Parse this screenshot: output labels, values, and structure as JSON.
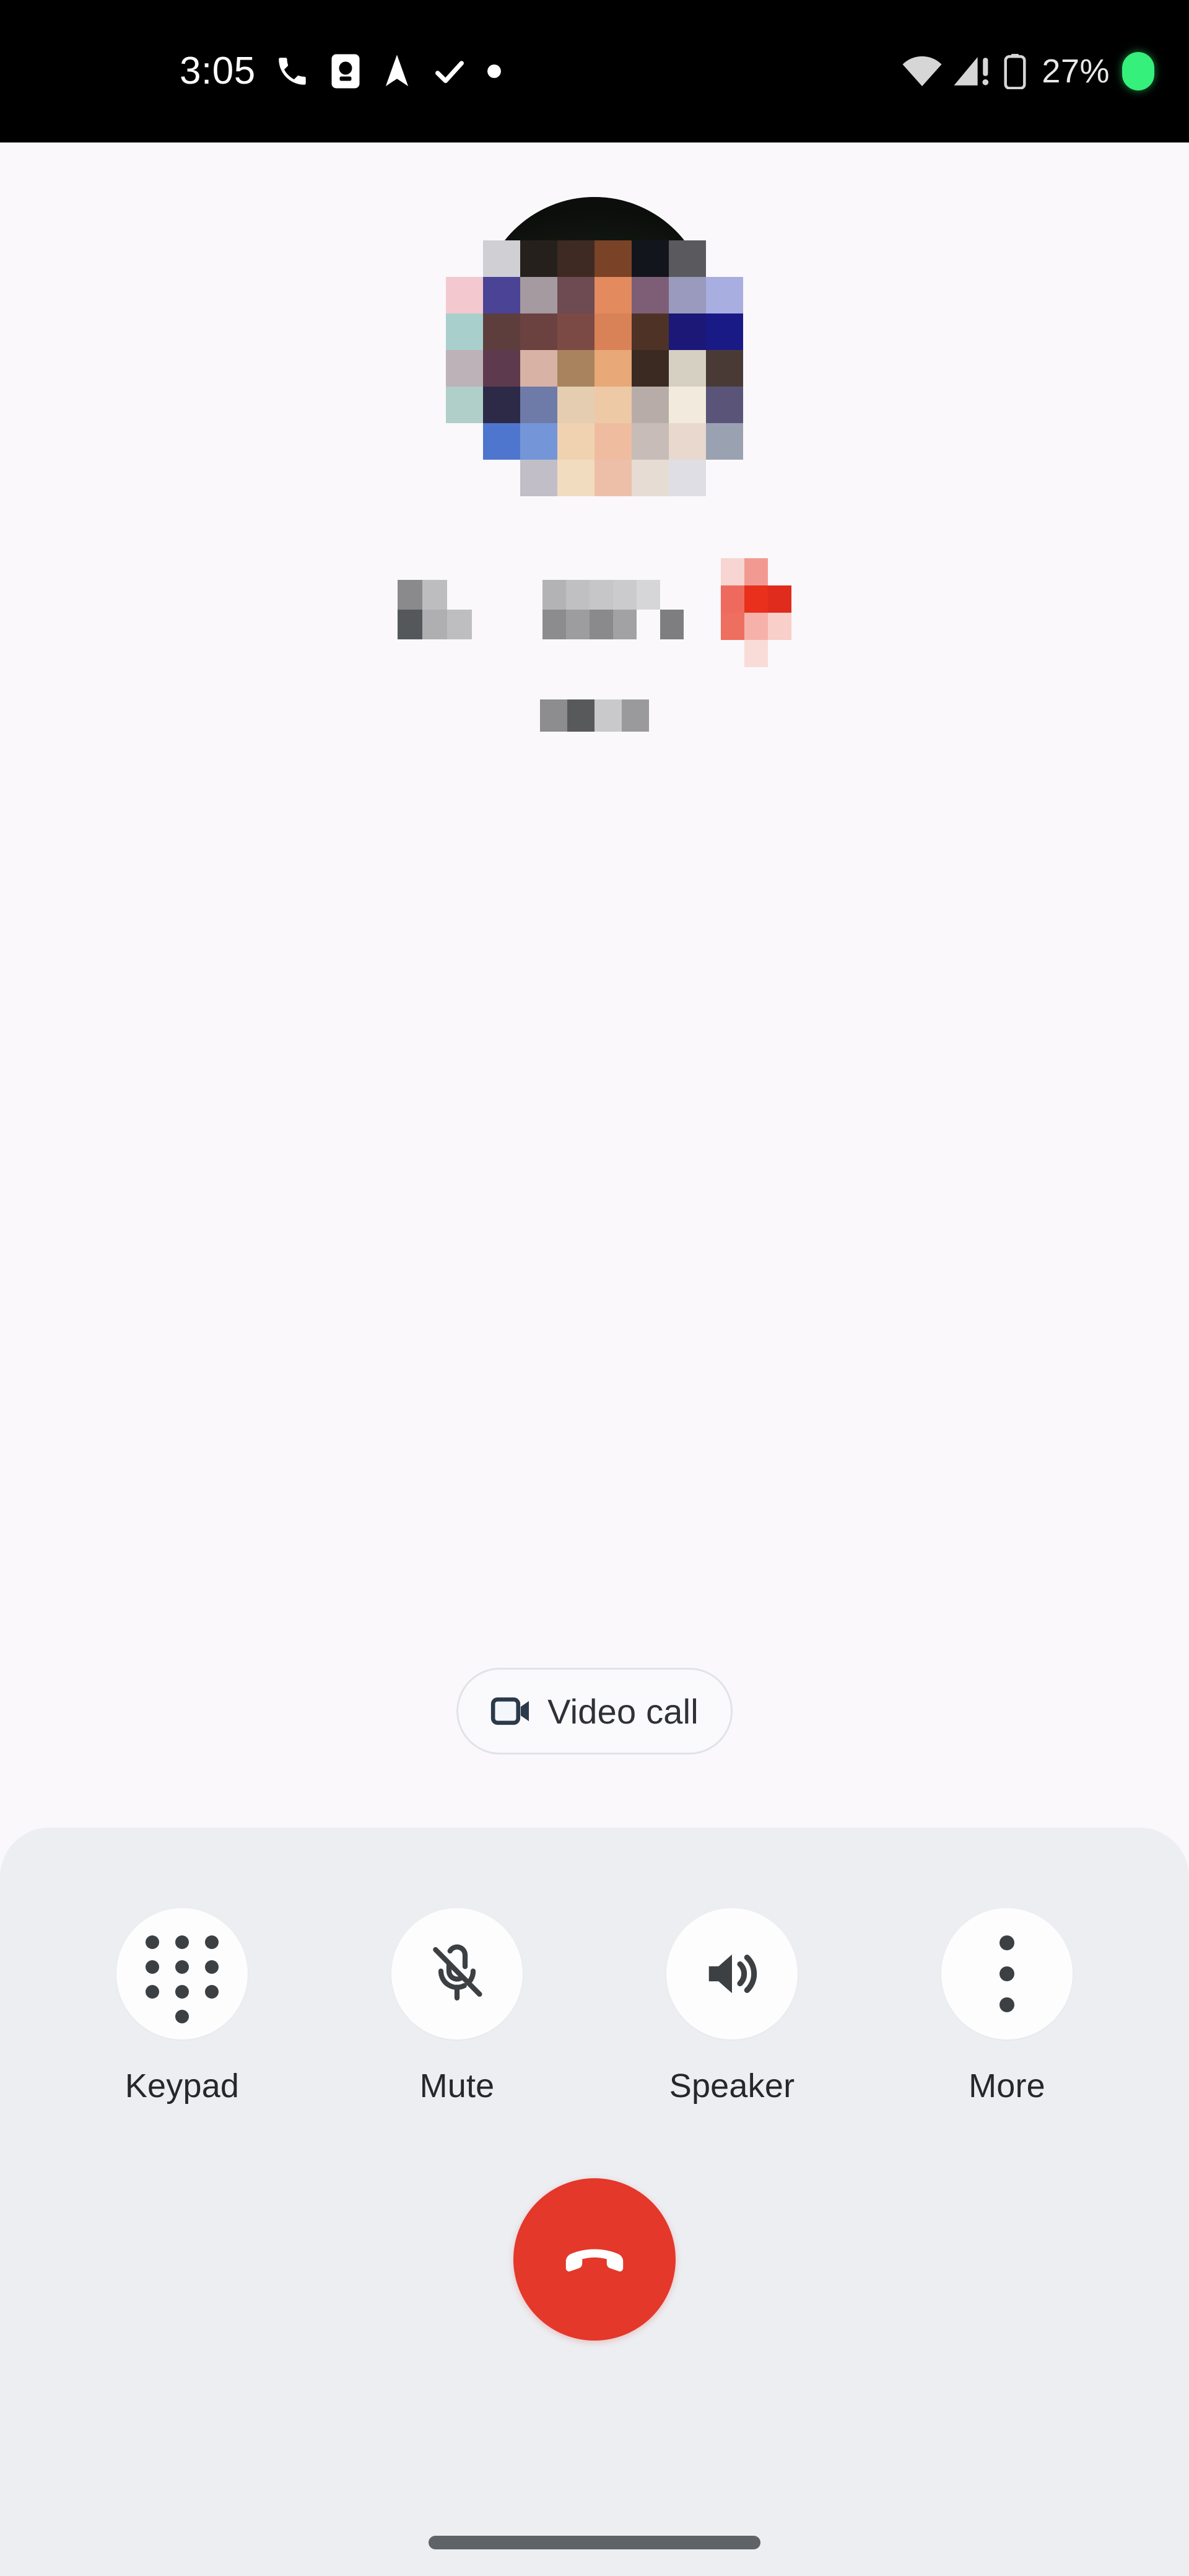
{
  "status_bar": {
    "time": "3:05",
    "battery_percent": "27%",
    "left_icons": [
      "phone-in-call-icon",
      "contact-card-icon",
      "navigation-arrow-icon",
      "checkmark-icon",
      "dot-icon"
    ],
    "right_icons": [
      "wifi-icon",
      "cellular-signal-warning-icon",
      "battery-icon",
      "privacy-indicator-dot"
    ],
    "colors": {
      "background": "#000000",
      "foreground": "#FFFFFF",
      "privacy_dot": "#35F07B"
    }
  },
  "call": {
    "contact_name_redacted": true,
    "contact_name": "",
    "call_status_redacted": true,
    "call_status": "",
    "avatar": "contact-avatar-pixelated",
    "video_call": {
      "label": "Video call",
      "icon": "video-camera-icon"
    }
  },
  "controls": {
    "buttons": [
      {
        "label": "Keypad",
        "icon": "dialpad-icon",
        "active": false
      },
      {
        "label": "Mute",
        "icon": "mic-off-icon",
        "active": false
      },
      {
        "label": "Speaker",
        "icon": "volume-up-icon",
        "active": false
      },
      {
        "label": "More",
        "icon": "more-vert-icon",
        "active": false
      }
    ],
    "end_call": {
      "label": "End call",
      "icon": "call-end-icon",
      "color": "#E3382A"
    }
  },
  "nav_bar": {
    "gesture_pill": "home-gesture-pill",
    "color": "#5F6368"
  },
  "theme": {
    "screen_background": "#FAF8FB",
    "panel_background": "#ECEEF2",
    "text_primary": "#24282C",
    "chip_border": "#E2E3E8",
    "icon_dark": "#3C4043",
    "video_icon": "#2B3A4A"
  }
}
